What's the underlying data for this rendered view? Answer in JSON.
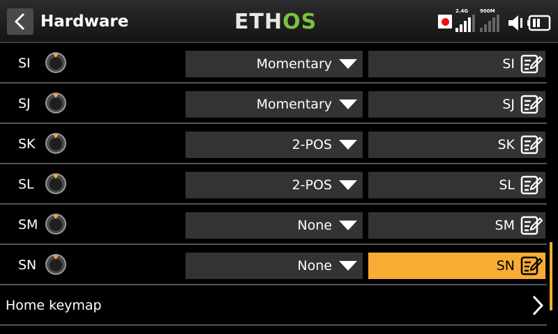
{
  "header": {
    "title": "Hardware",
    "logo_part1": "ETH",
    "logo_part2": "OS",
    "rf_band_1": "2.4G",
    "rf_band_2": "900M"
  },
  "switches": [
    {
      "label": "SI",
      "mode": "Momentary",
      "name": "SI",
      "selected": false
    },
    {
      "label": "SJ",
      "mode": "Momentary",
      "name": "SJ",
      "selected": false
    },
    {
      "label": "SK",
      "mode": "2-POS",
      "name": "SK",
      "selected": false
    },
    {
      "label": "SL",
      "mode": "2-POS",
      "name": "SL",
      "selected": false
    },
    {
      "label": "SM",
      "mode": "None",
      "name": "SM",
      "selected": false
    },
    {
      "label": "SN",
      "mode": "None",
      "name": "SN",
      "selected": true
    }
  ],
  "home_keymap": {
    "label": "Home keymap"
  },
  "colors": {
    "accent": "#f7ac33",
    "logo_green": "#7ac143",
    "field_bg": "#333333"
  }
}
